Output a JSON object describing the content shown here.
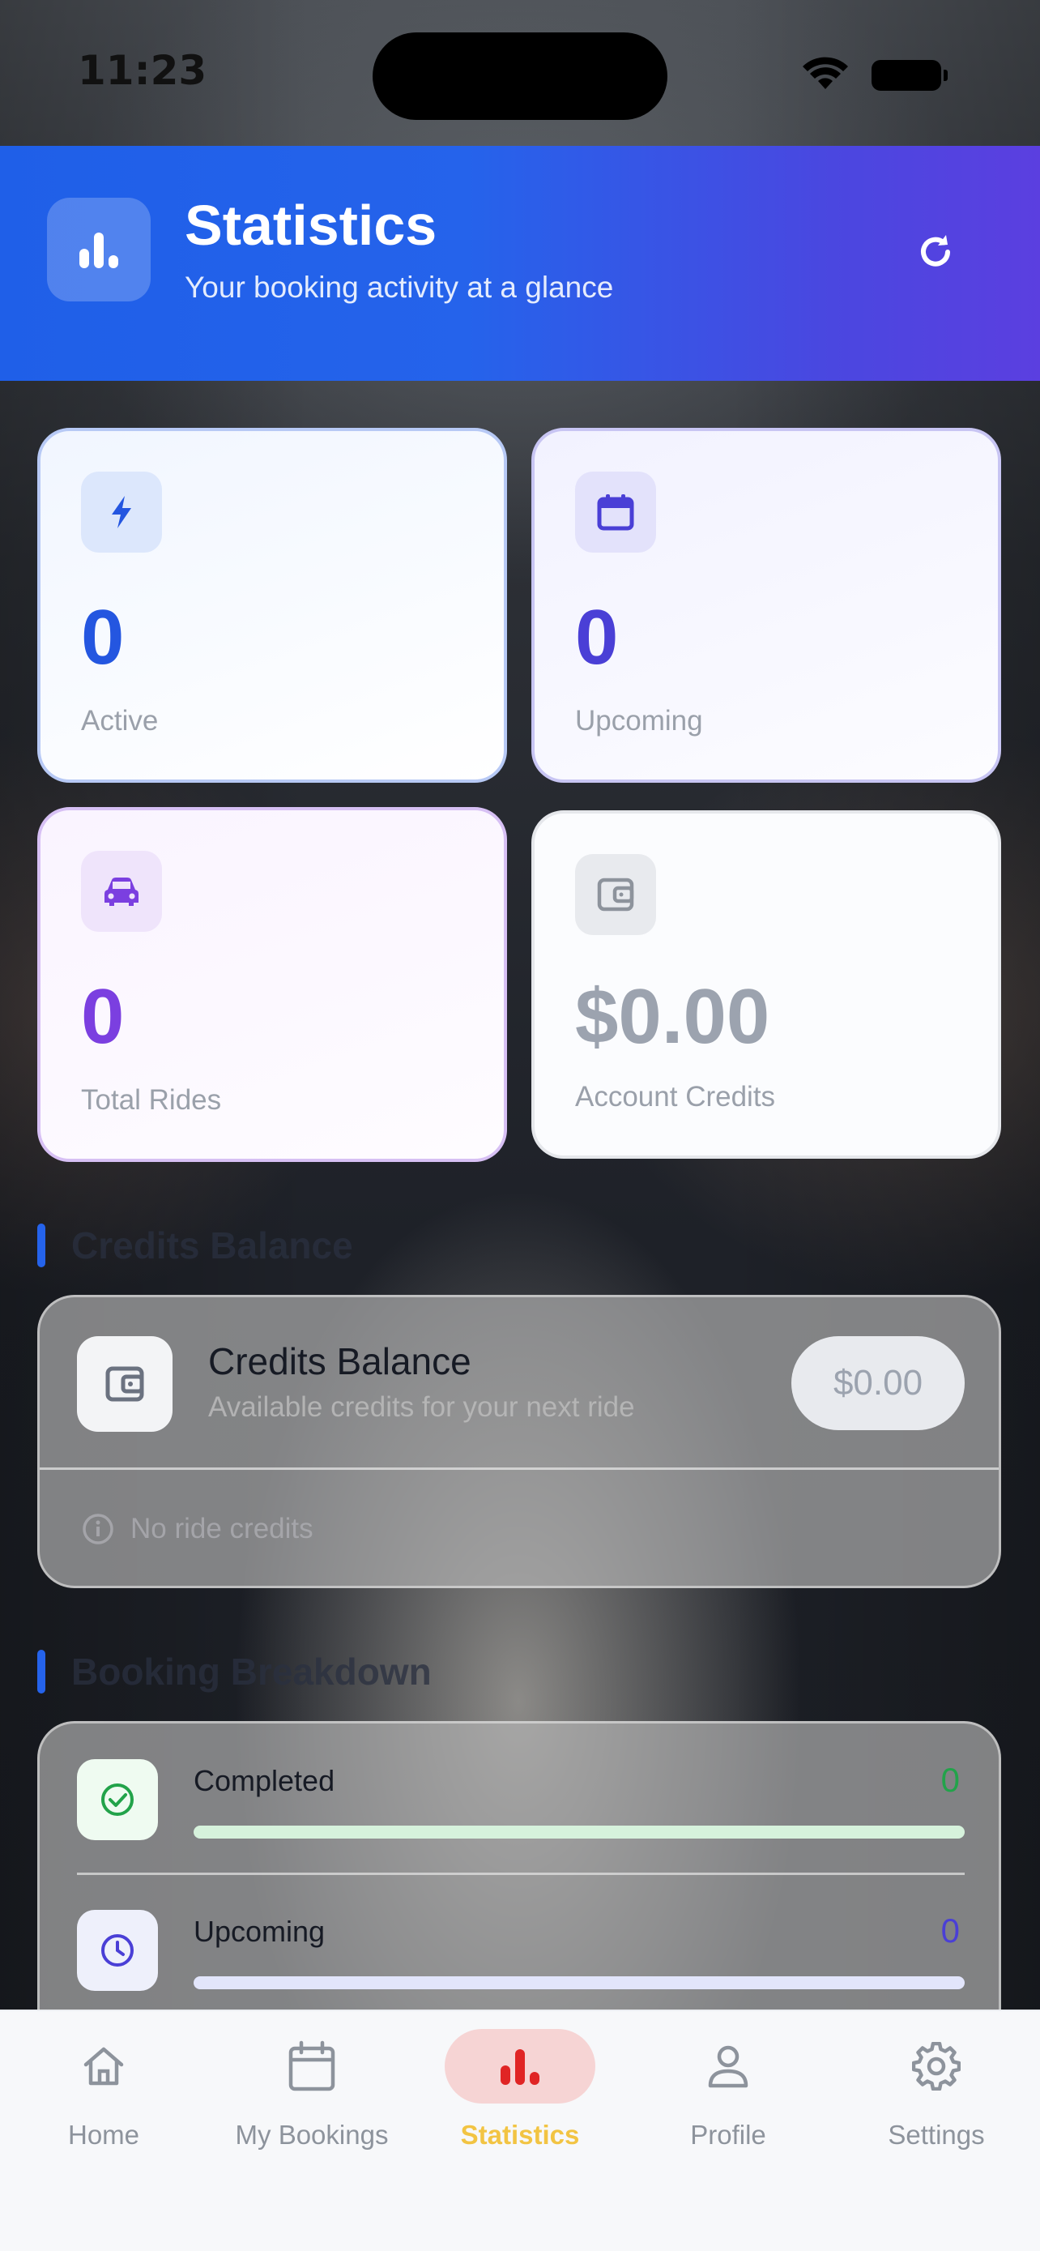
{
  "status_bar": {
    "time": "11:23"
  },
  "header": {
    "title": "Statistics",
    "subtitle": "Your booking activity at a glance",
    "icon": "bar-chart-icon",
    "refresh_icon": "refresh-icon"
  },
  "stats": [
    {
      "value": "0",
      "label": "Active",
      "icon": "lightning-icon",
      "color": "#2456e0"
    },
    {
      "value": "0",
      "label": "Upcoming",
      "icon": "calendar-icon",
      "color": "#4a3fd6"
    },
    {
      "value": "0",
      "label": "Total Rides",
      "icon": "car-icon",
      "color": "#7b3fe0"
    },
    {
      "value": "$0.00",
      "label": "Account Credits",
      "icon": "wallet-icon",
      "color": "#9ca3af"
    }
  ],
  "credits_section": {
    "title": "Credits Balance",
    "card_title": "Credits Balance",
    "card_subtitle": "Available credits for your next ride",
    "amount": "$0.00",
    "note": "No ride credits"
  },
  "breakdown_section": {
    "title": "Booking Breakdown",
    "rows": [
      {
        "label": "Completed",
        "count": "0",
        "progress": 0,
        "color": "#22a34a",
        "track": "#d6f2dc",
        "icon": "check-circle-icon"
      },
      {
        "label": "Upcoming",
        "count": "0",
        "progress": 0,
        "color": "#4a3fd6",
        "track": "#e2e5fb",
        "icon": "clock-icon"
      }
    ]
  },
  "tab_bar": {
    "items": [
      {
        "label": "Home",
        "icon": "home-icon",
        "selected": false
      },
      {
        "label": "My Bookings",
        "icon": "calendar-icon",
        "selected": false
      },
      {
        "label": "Statistics",
        "icon": "bar-chart-icon",
        "selected": true
      },
      {
        "label": "Profile",
        "icon": "person-icon",
        "selected": false
      },
      {
        "label": "Settings",
        "icon": "gear-icon",
        "selected": false
      }
    ]
  }
}
